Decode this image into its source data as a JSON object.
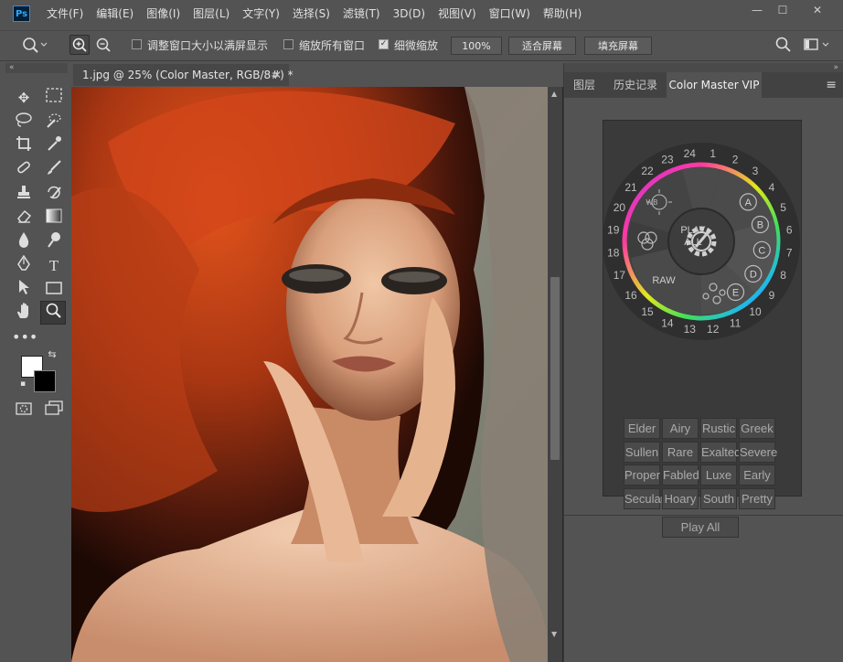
{
  "app": {
    "logo": "Ps"
  },
  "menu": [
    "文件(F)",
    "编辑(E)",
    "图像(I)",
    "图层(L)",
    "文字(Y)",
    "选择(S)",
    "滤镜(T)",
    "3D(D)",
    "视图(V)",
    "窗口(W)",
    "帮助(H)"
  ],
  "window_controls": {
    "minimize": "—",
    "maximize": "☐",
    "close": "✕"
  },
  "options": {
    "resize_windows_label": "调整窗口大小以满屏显示",
    "resize_windows_checked": false,
    "zoom_all_label": "缩放所有窗口",
    "zoom_all_checked": false,
    "scrubby_zoom_label": "细微缩放",
    "scrubby_zoom_checked": true,
    "zoom_percent": "100%",
    "fit_screen": "适合屏幕",
    "fill_screen": "填充屏幕"
  },
  "document": {
    "tab_title": "1.jpg @ 25% (Color Master, RGB/8#) *",
    "close": "✕"
  },
  "panel": {
    "tabs": [
      "图层",
      "历史记录",
      "Color Master VIP"
    ],
    "active_tab": "Color Master VIP"
  },
  "color_master": {
    "dial_numbers": [
      "1",
      "2",
      "3",
      "4",
      "5",
      "6",
      "7",
      "8",
      "9",
      "10",
      "11",
      "12",
      "13",
      "14",
      "15",
      "16",
      "17",
      "18",
      "19",
      "20",
      "21",
      "22",
      "23",
      "24"
    ],
    "play_all_line1": "PLAY",
    "play_all_line2": "ALL",
    "wb_label": "WB",
    "raw_label": "RAW",
    "letters": [
      "A",
      "B",
      "C",
      "D",
      "E"
    ],
    "presets": [
      [
        "Elder",
        "Airy",
        "Rustic",
        "Greek"
      ],
      [
        "Sullen",
        "Rare",
        "Exalted",
        "Severe"
      ],
      [
        "Proper",
        "Fabled",
        "Luxe",
        "Early"
      ],
      [
        "Secular",
        "Hoary",
        "South",
        "Pretty"
      ]
    ],
    "play_all_button": "Play All"
  }
}
